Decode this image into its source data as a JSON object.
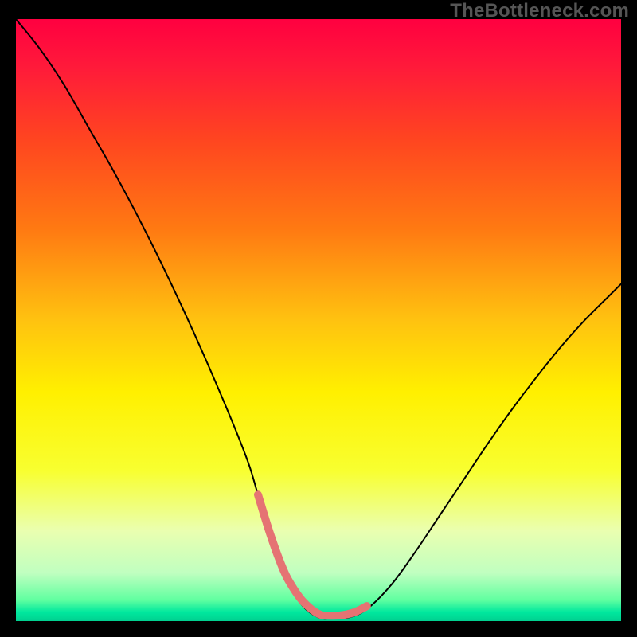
{
  "watermark": "TheBottleneck.com",
  "chart_data": {
    "type": "line",
    "title": "",
    "xlabel": "",
    "ylabel": "",
    "xlim": [
      0,
      100
    ],
    "ylim": [
      0,
      100
    ],
    "grid": false,
    "legend": false,
    "annotations": [],
    "gradient_stops": [
      {
        "offset": 0.0,
        "color": "#ff0040"
      },
      {
        "offset": 0.08,
        "color": "#ff1a3a"
      },
      {
        "offset": 0.2,
        "color": "#ff4520"
      },
      {
        "offset": 0.35,
        "color": "#ff7a12"
      },
      {
        "offset": 0.5,
        "color": "#ffc210"
      },
      {
        "offset": 0.62,
        "color": "#fff000"
      },
      {
        "offset": 0.75,
        "color": "#f8ff30"
      },
      {
        "offset": 0.85,
        "color": "#eaffb0"
      },
      {
        "offset": 0.92,
        "color": "#c0ffc0"
      },
      {
        "offset": 0.965,
        "color": "#60ffa0"
      },
      {
        "offset": 0.985,
        "color": "#00e89e"
      },
      {
        "offset": 1.0,
        "color": "#00d090"
      }
    ],
    "series": [
      {
        "name": "bottleneck-curve",
        "color": "#000000",
        "width": 2.0,
        "x": [
          0.0,
          4.0,
          8.0,
          12.0,
          16.0,
          20.0,
          24.0,
          28.0,
          32.0,
          36.0,
          38.5,
          40.0,
          42.0,
          44.5,
          47.0,
          50.0,
          52.5,
          55.0,
          58.0,
          62.0,
          66.0,
          70.0,
          74.0,
          78.0,
          82.0,
          86.0,
          90.0,
          94.0,
          98.0,
          100.0
        ],
        "y": [
          100.0,
          95.0,
          89.0,
          82.0,
          75.0,
          67.5,
          59.5,
          51.0,
          42.0,
          32.5,
          26.0,
          21.0,
          14.5,
          8.0,
          3.0,
          0.6,
          0.5,
          0.6,
          2.0,
          6.0,
          11.5,
          17.5,
          23.5,
          29.5,
          35.2,
          40.5,
          45.5,
          50.0,
          54.0,
          56.0
        ]
      },
      {
        "name": "sweet-spot-marker",
        "color": "#e57373",
        "width": 10.0,
        "x": [
          40.0,
          42.0,
          44.0,
          45.5,
          47.5,
          50.0,
          52.0,
          54.0,
          56.0,
          58.0
        ],
        "y": [
          21.0,
          14.5,
          9.0,
          6.0,
          3.2,
          1.2,
          0.9,
          1.0,
          1.5,
          2.5
        ]
      }
    ]
  }
}
